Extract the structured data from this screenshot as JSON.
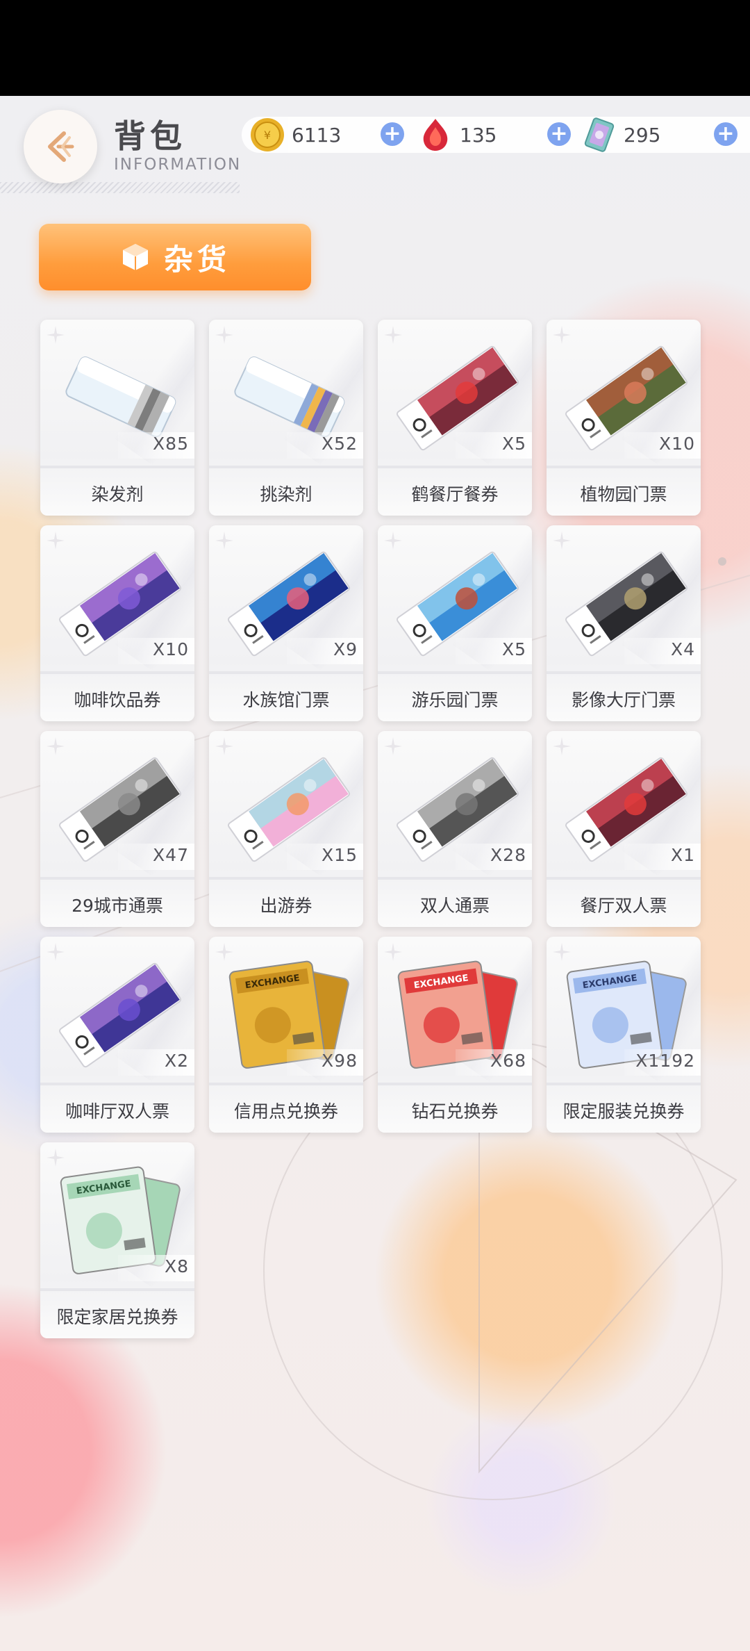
{
  "header": {
    "title": "背包",
    "subtitle": "INFORMATION",
    "back_icon": "back-arrow-icon"
  },
  "currencies": [
    {
      "icon": "gold-coin-icon",
      "value": "6113"
    },
    {
      "icon": "red-gem-icon",
      "value": "135"
    },
    {
      "icon": "crystal-card-icon",
      "value": "295"
    }
  ],
  "category": {
    "label": "杂货",
    "icon": "cube-icon"
  },
  "items": [
    {
      "name": "染发剂",
      "qty": "X85",
      "icon": "hair-dye-box-icon"
    },
    {
      "name": "挑染剂",
      "qty": "X52",
      "icon": "highlight-dye-box-icon"
    },
    {
      "name": "鹤餐厅餐券",
      "qty": "X5",
      "icon": "restaurant-ticket-icon"
    },
    {
      "name": "植物园门票",
      "qty": "X10",
      "icon": "botanical-garden-ticket-icon"
    },
    {
      "name": "咖啡饮品券",
      "qty": "X10",
      "icon": "coffee-drink-ticket-icon"
    },
    {
      "name": "水族馆门票",
      "qty": "X9",
      "icon": "aquarium-ticket-icon"
    },
    {
      "name": "游乐园门票",
      "qty": "X5",
      "icon": "amusement-park-ticket-icon"
    },
    {
      "name": "影像大厅门票",
      "qty": "X4",
      "icon": "cinema-hall-ticket-icon"
    },
    {
      "name": "29城市通票",
      "qty": "X47",
      "icon": "city-pass-ticket-icon"
    },
    {
      "name": "出游券",
      "qty": "X15",
      "icon": "outing-ticket-icon"
    },
    {
      "name": "双人通票",
      "qty": "X28",
      "icon": "duo-pass-ticket-icon"
    },
    {
      "name": "餐厅双人票",
      "qty": "X1",
      "icon": "restaurant-duo-ticket-icon"
    },
    {
      "name": "咖啡厅双人票",
      "qty": "X2",
      "icon": "cafe-duo-ticket-icon"
    },
    {
      "name": "信用点兑换券",
      "qty": "X98",
      "icon": "credit-exchange-voucher-icon"
    },
    {
      "name": "钻石兑换券",
      "qty": "X68",
      "icon": "diamond-exchange-voucher-icon"
    },
    {
      "name": "限定服装兑换券",
      "qty": "X1192",
      "icon": "outfit-exchange-voucher-icon"
    },
    {
      "name": "限定家居兑换券",
      "qty": "X8",
      "icon": "furniture-exchange-voucher-icon"
    }
  ]
}
